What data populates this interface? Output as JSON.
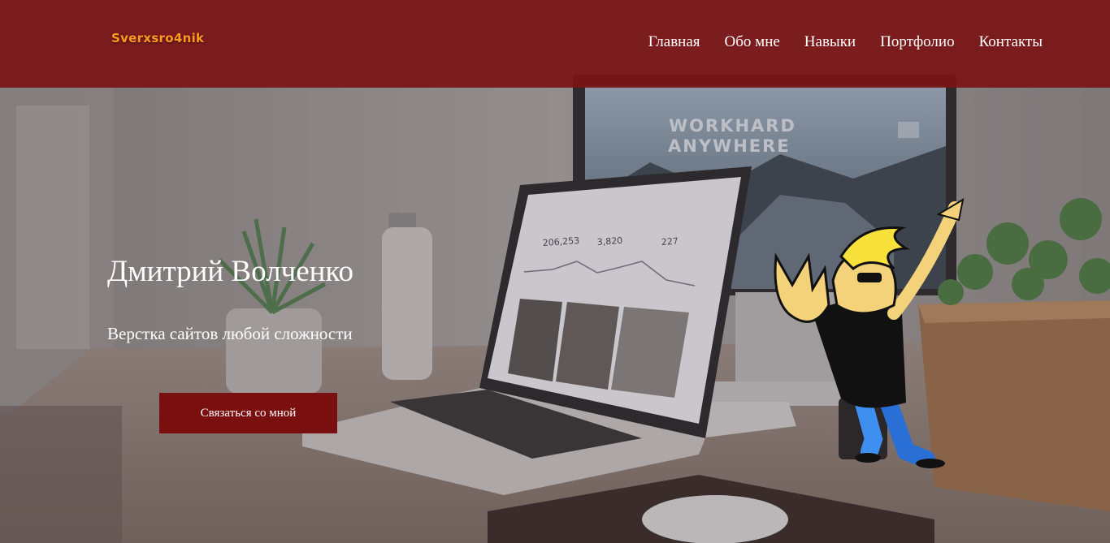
{
  "header": {
    "logo_text": "Sverxsro4nik",
    "nav": [
      {
        "label": "Главная"
      },
      {
        "label": "Обо мне"
      },
      {
        "label": "Навыки"
      },
      {
        "label": "Портфолио"
      },
      {
        "label": "Контакты"
      }
    ]
  },
  "hero": {
    "title": "Дмитрий Волченко",
    "subtitle": "Верстка сайтов любой сложности",
    "cta_label": "Связаться со мной"
  },
  "background": {
    "monitor_text_line1": "WORKHARD",
    "monitor_text_line2": "ANYWHERE",
    "laptop_stats": [
      "206,253",
      "3,820",
      "227"
    ]
  },
  "colors": {
    "header_bg": "#7a1416",
    "logo": "#ff9a1f",
    "cta_bg": "#7a0f10",
    "text": "#ffffff"
  }
}
